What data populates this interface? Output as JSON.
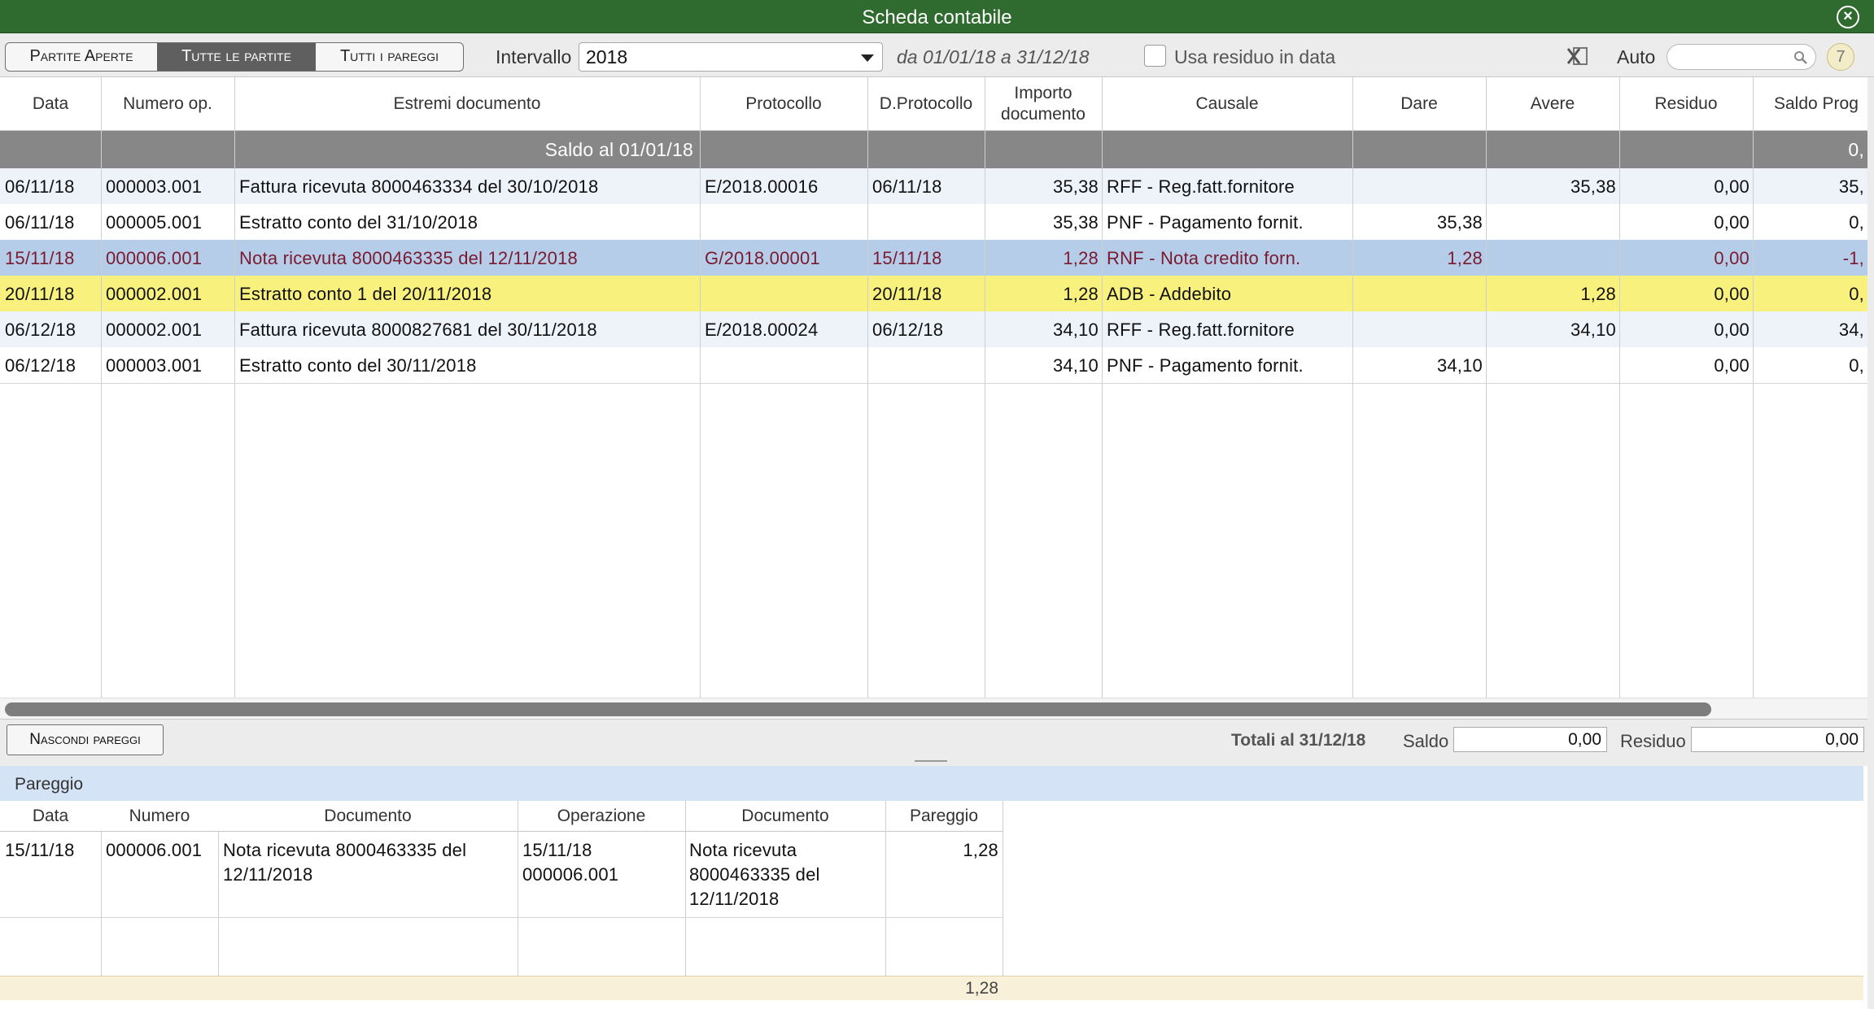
{
  "window": {
    "title": "Scheda contabile"
  },
  "toolbar": {
    "segments": [
      "Partite Aperte",
      "Tutte le partite",
      "Tutti i pareggi"
    ],
    "active_segment": "Tutte le partite",
    "interval_label": "Intervallo",
    "interval_value": "2018",
    "date_range": "da 01/01/18 a 31/12/18",
    "residuo_checkbox_label": "Usa residuo in data",
    "residuo_checked": false,
    "auto_label": "Auto",
    "search_value": "",
    "count_badge": "7"
  },
  "main_table": {
    "columns": [
      "Data",
      "Numero op.",
      "Estremi documento",
      "Protocollo",
      "D.Protocollo",
      "Importo documento",
      "Causale",
      "Dare",
      "Avere",
      "Residuo",
      "Saldo Prog"
    ],
    "saldo_row": {
      "label": "Saldo al 01/01/18",
      "saldo_prog": "0,"
    },
    "rows": [
      {
        "data": "06/11/18",
        "numero": "000003.001",
        "estremi": "Fattura ricevuta 8000463334 del 30/10/2018",
        "protocollo": "E/2018.00016",
        "d_protocollo": "06/11/18",
        "importo": "35,38",
        "causale": "RFF - Reg.fatt.fornitore",
        "dare": "",
        "avere": "35,38",
        "residuo": "0,00",
        "saldo_prog": "35,",
        "style": "alt"
      },
      {
        "data": "06/11/18",
        "numero": "000005.001",
        "estremi": "Estratto conto del 31/10/2018",
        "protocollo": "",
        "d_protocollo": "",
        "importo": "35,38",
        "causale": "PNF - Pagamento fornit.",
        "dare": "35,38",
        "avere": "",
        "residuo": "0,00",
        "saldo_prog": "0,",
        "style": "normal"
      },
      {
        "data": "15/11/18",
        "numero": "000006.001",
        "estremi": "Nota ricevuta 8000463335 del 12/11/2018",
        "protocollo": "G/2018.00001",
        "d_protocollo": "15/11/18",
        "importo": "1,28",
        "causale": "RNF - Nota credito forn.",
        "dare": "1,28",
        "avere": "",
        "residuo": "0,00",
        "saldo_prog": "-1,",
        "style": "selected"
      },
      {
        "data": "20/11/18",
        "numero": "000002.001",
        "estremi": "Estratto conto 1 del 20/11/2018",
        "protocollo": "",
        "d_protocollo": "20/11/18",
        "importo": "1,28",
        "causale": "ADB - Addebito",
        "dare": "",
        "avere": "1,28",
        "residuo": "0,00",
        "saldo_prog": "0,",
        "style": "yellow"
      },
      {
        "data": "06/12/18",
        "numero": "000002.001",
        "estremi": "Fattura ricevuta 8000827681 del 30/11/2018",
        "protocollo": "E/2018.00024",
        "d_protocollo": "06/12/18",
        "importo": "34,10",
        "causale": "RFF - Reg.fatt.fornitore",
        "dare": "",
        "avere": "34,10",
        "residuo": "0,00",
        "saldo_prog": "34,",
        "style": "alt"
      },
      {
        "data": "06/12/18",
        "numero": "000003.001",
        "estremi": "Estratto conto del 30/11/2018",
        "protocollo": "",
        "d_protocollo": "",
        "importo": "34,10",
        "causale": "PNF - Pagamento fornit.",
        "dare": "34,10",
        "avere": "",
        "residuo": "0,00",
        "saldo_prog": "0,",
        "style": "normal"
      }
    ]
  },
  "totals": {
    "hide_button": "Nascondi pareggi",
    "label": "Totali al 31/12/18",
    "saldo_label": "Saldo",
    "saldo_value": "0,00",
    "residuo_label": "Residuo",
    "residuo_value": "0,00"
  },
  "pareggio": {
    "title": "Pareggio",
    "columns": [
      "Data",
      "Numero",
      "Documento",
      "Operazione",
      "Documento",
      "Pareggio"
    ],
    "rows": [
      {
        "data": "15/11/18",
        "numero": "000006.001",
        "documento": [
          "Nota ricevuta 8000463335 del",
          "12/11/2018"
        ],
        "operazione": [
          "15/11/18",
          "000006.001"
        ],
        "documento2": [
          "Nota ricevuta",
          "8000463335 del",
          "12/11/2018"
        ],
        "pareggio": "1,28"
      }
    ],
    "total": "1,28"
  },
  "colors": {
    "titlebar": "#2f6b2f",
    "selected_row": "#b6cdea",
    "yellow_row": "#f8f17e",
    "saldo_row": "#878787",
    "pareggio_bar": "#d4e3f6"
  }
}
